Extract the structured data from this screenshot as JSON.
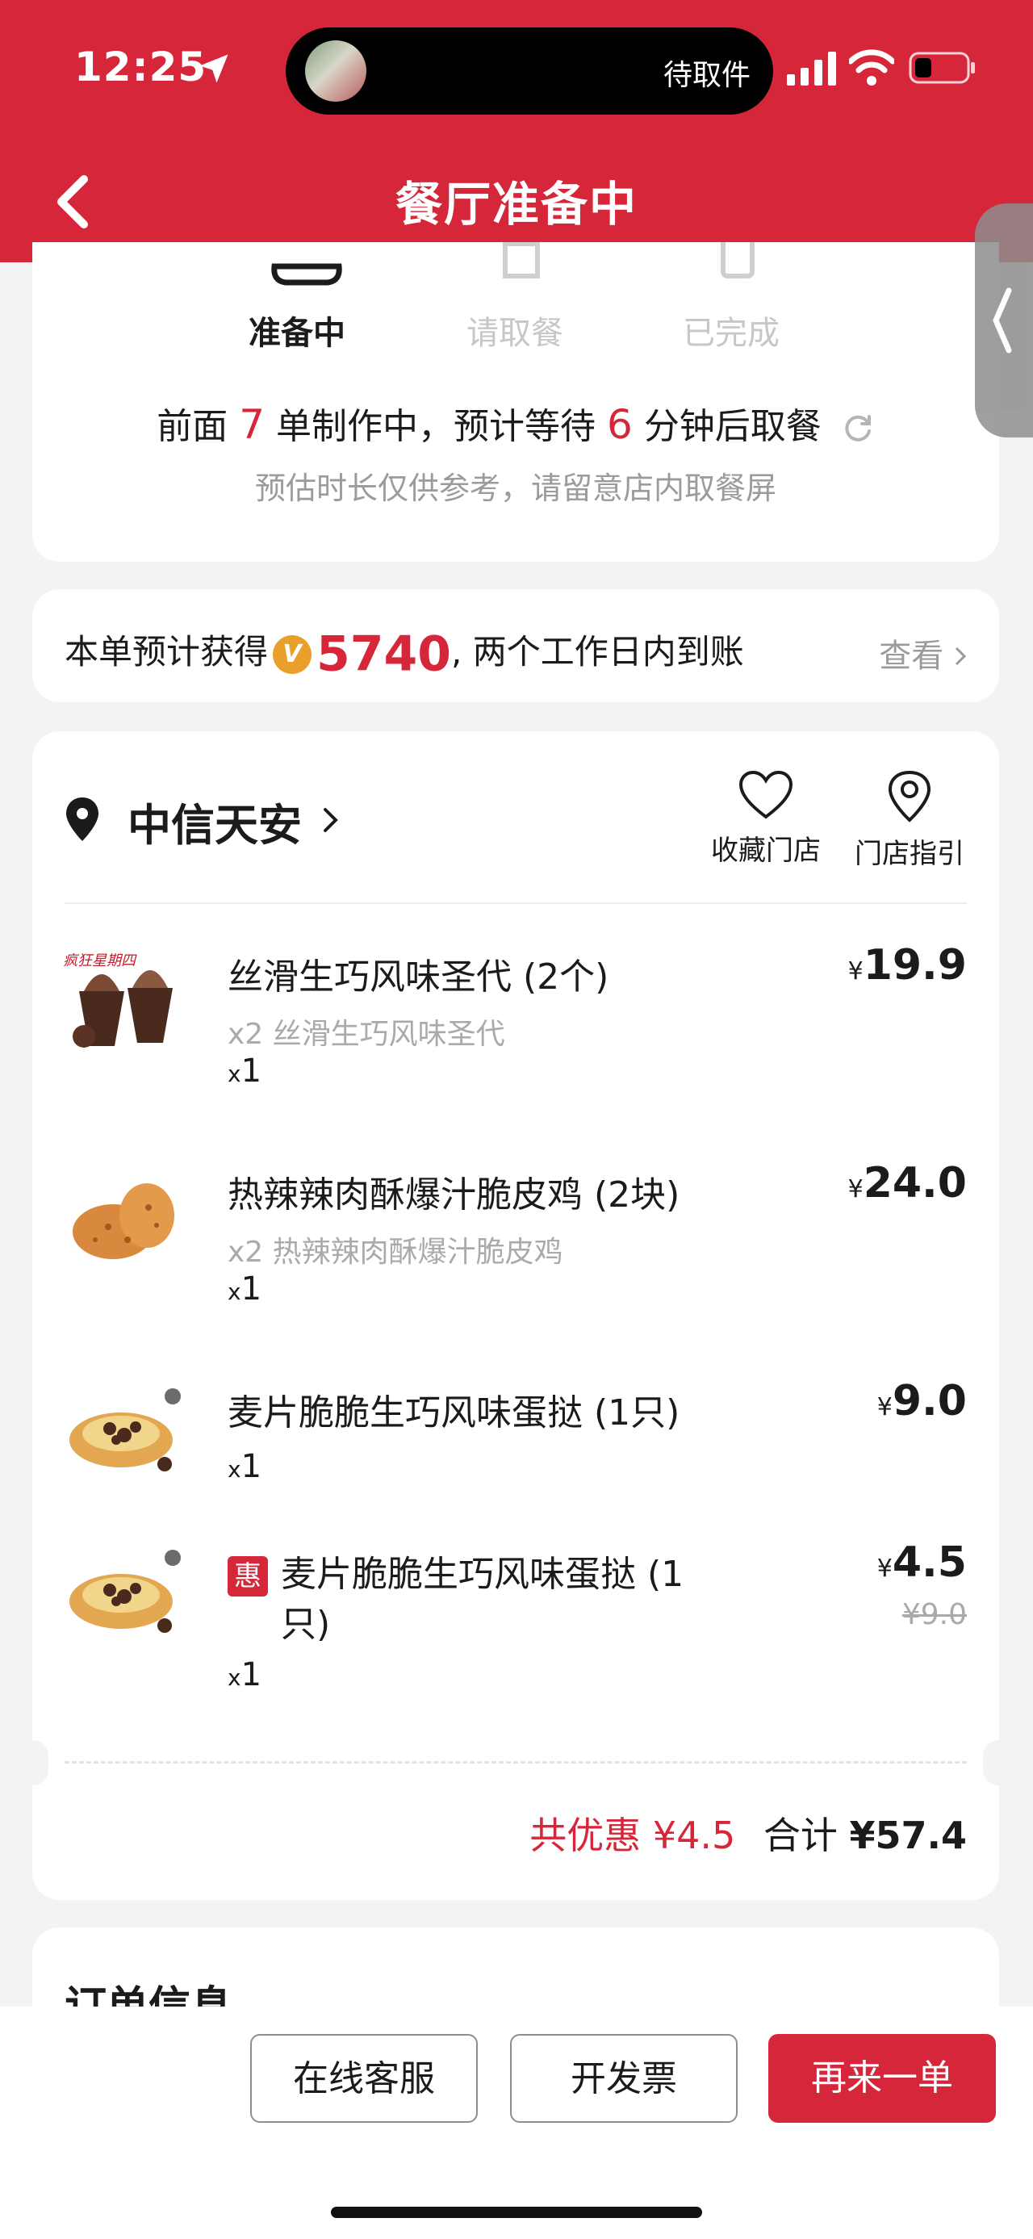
{
  "status_bar": {
    "time": "12:25",
    "island_text": "待取件"
  },
  "header": {
    "title": "餐厅准备中"
  },
  "progress": {
    "steps": [
      {
        "label": "准备中",
        "active": true
      },
      {
        "label": "请取餐",
        "active": false
      },
      {
        "label": "已完成",
        "active": false
      }
    ],
    "queue_prefix": "前面",
    "queue_count": "7",
    "queue_middle": "单制作中，预计等待",
    "wait_minutes": "6",
    "queue_suffix": "分钟后取餐",
    "hint": "预估时长仅供参考，请留意店内取餐屏"
  },
  "points": {
    "prefix": "本单预计获得",
    "coin_symbol": "V",
    "amount": "5740",
    "suffix": ", 两个工作日内到账",
    "view_label": "查看"
  },
  "store": {
    "name": "中信天安",
    "favorite_label": "收藏门店",
    "guide_label": "门店指引"
  },
  "items": [
    {
      "name": "丝滑生巧风味圣代 (2个)",
      "sub": "x2 丝滑生巧风味圣代",
      "qty": "1",
      "currency": "¥",
      "price": "19.9"
    },
    {
      "name": "热辣辣肉酥爆汁脆皮鸡 (2块)",
      "sub": "x2 热辣辣肉酥爆汁脆皮鸡",
      "qty": "1",
      "currency": "¥",
      "price": "24.0"
    },
    {
      "name": "麦片脆脆生巧风味蛋挞 (1只)",
      "qty": "1",
      "currency": "¥",
      "price": "9.0"
    },
    {
      "badge": "惠",
      "name_line1": "麦片脆脆生巧风味蛋挞 (1",
      "name_line2": "只)",
      "qty": "1",
      "currency": "¥",
      "price": "4.5",
      "original_price": "¥9.0"
    }
  ],
  "qty_prefix": "x",
  "totals": {
    "discount_label": "共优惠",
    "discount_value": "¥4.5",
    "total_label": "合计",
    "total_value": "¥57.4"
  },
  "order_info": {
    "title": "订单信息"
  },
  "actions": {
    "service": "在线客服",
    "invoice": "开发票",
    "reorder": "再来一单"
  },
  "colors": {
    "brand_red": "#d6273a",
    "muted_gray": "#9b9b9b",
    "coin_gold": "#e9a02a"
  }
}
